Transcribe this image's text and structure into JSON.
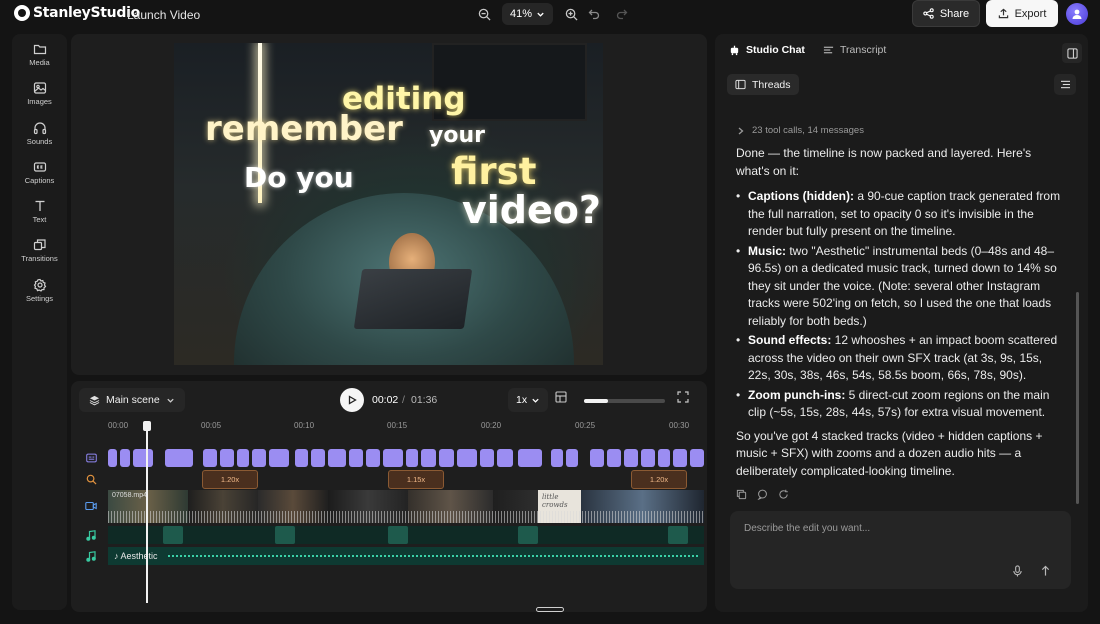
{
  "app": {
    "logo_text": "StanleyStudio",
    "project_title": "Launch Video",
    "zoom_level": "41%",
    "share_label": "Share",
    "export_label": "Export"
  },
  "sidebar": {
    "items": [
      {
        "label": "Media",
        "icon": "folder-icon"
      },
      {
        "label": "Images",
        "icon": "image-icon"
      },
      {
        "label": "Sounds",
        "icon": "headphones-icon"
      },
      {
        "label": "Captions",
        "icon": "captions-icon"
      },
      {
        "label": "Text",
        "icon": "text-icon"
      },
      {
        "label": "Transitions",
        "icon": "transitions-icon"
      },
      {
        "label": "Settings",
        "icon": "gear-icon"
      }
    ]
  },
  "preview": {
    "caption_words": [
      "editing",
      "remember",
      "your",
      "Do you",
      "first",
      "video?"
    ]
  },
  "timeline": {
    "scene_label": "Main scene",
    "current_time": "00:02",
    "separator": "/",
    "total_time": "01:36",
    "speed": "1x",
    "playback_progress": 0.3,
    "ruler_ticks": [
      "00:00",
      "00:05",
      "00:10",
      "00:15",
      "00:20",
      "00:25",
      "00:30"
    ],
    "zoom_regions": [
      "1.20x",
      "1.15x",
      "1.20x"
    ],
    "video_clip_label": "07058.mp4",
    "clip_thumb_text": "little crowds",
    "music_track_label": "Aesthetic"
  },
  "chat": {
    "tab_studio": "Studio Chat",
    "tab_transcript": "Transcript",
    "threads_label": "Threads",
    "tool_calls_summary": "23 tool calls, 14 messages",
    "intro": "Done — the timeline is now packed and layered. Here's what's on it:",
    "bullets": [
      {
        "title": "Captions (hidden):",
        "text": " a 90-cue caption track generated from the full narration, set to opacity 0 so it's invisible in the render but fully present on the timeline."
      },
      {
        "title": "Music:",
        "text": " two \"Aesthetic\" instrumental beds (0–48s and 48–96.5s) on a dedicated music track, turned down to 14% so they sit under the voice. (Note: several other Instagram tracks were 502'ing on fetch, so I used the one that loads reliably for both beds.)"
      },
      {
        "title": "Sound effects:",
        "text": " 12 whooshes + an impact boom scattered across the video on their own SFX track (at 3s, 9s, 15s, 22s, 30s, 38s, 46s, 54s, 58.5s boom, 66s, 78s, 90s)."
      },
      {
        "title": "Zoom punch-ins:",
        "text": " 5 direct-cut zoom regions on the main clip (~5s, 15s, 28s, 44s, 57s) for extra visual movement."
      }
    ],
    "outro": "So you've got 4 stacked tracks (video + hidden captions + music + SFX) with zooms and a dozen audio hits — a deliberately complicated-looking timeline.",
    "composer_placeholder": "Describe the edit you want..."
  }
}
